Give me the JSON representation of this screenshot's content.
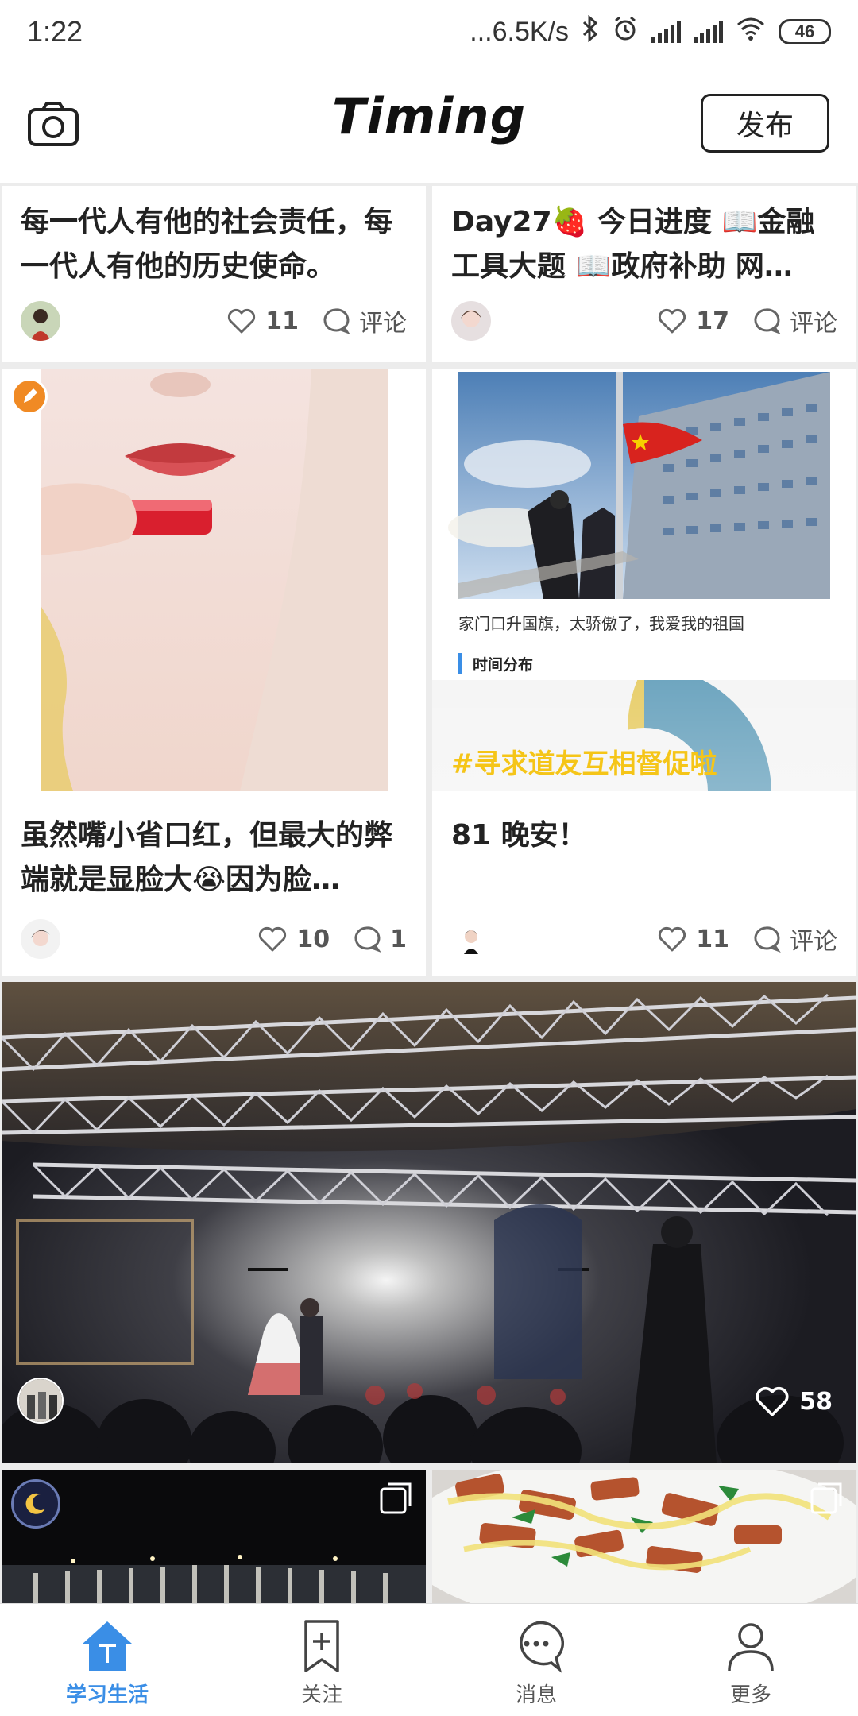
{
  "status": {
    "time": "1:22",
    "net": "...6.5K/s",
    "battery": "46"
  },
  "header": {
    "title": "Timing",
    "publish": "发布",
    "camera_icon": "camera-icon"
  },
  "cards": [
    {
      "title": "每一代人有他的社会责任，每一代人有他的历史使命。",
      "likes": "11",
      "comments": "评论"
    },
    {
      "title": "Day27🍓 今日进度 📖金融工具大题 📖政府补助 网…",
      "likes": "17",
      "comments": "评论"
    },
    {
      "title": "虽然嘴小省口红，但最大的弊端就是显脸大😭因为脸…",
      "likes": "10",
      "comments": "1"
    },
    {
      "title": "81 晚安！",
      "likes": "11",
      "comments": "评论",
      "caption": "家门口升国旗，太骄傲了，我爱我的祖国",
      "section": "时间分布",
      "hashtag": "#寻求道友互相督促啦"
    },
    {
      "likes": "58"
    }
  ],
  "nav": [
    {
      "label": "学习生活",
      "icon": "home-t-icon",
      "active": true
    },
    {
      "label": "关注",
      "icon": "bookmark-plus-icon",
      "active": false
    },
    {
      "label": "消息",
      "icon": "chat-bubble-icon",
      "active": false
    },
    {
      "label": "更多",
      "icon": "person-icon",
      "active": false
    }
  ],
  "colors": {
    "accent": "#3a8ee6",
    "hashtag": "#f5c518"
  }
}
